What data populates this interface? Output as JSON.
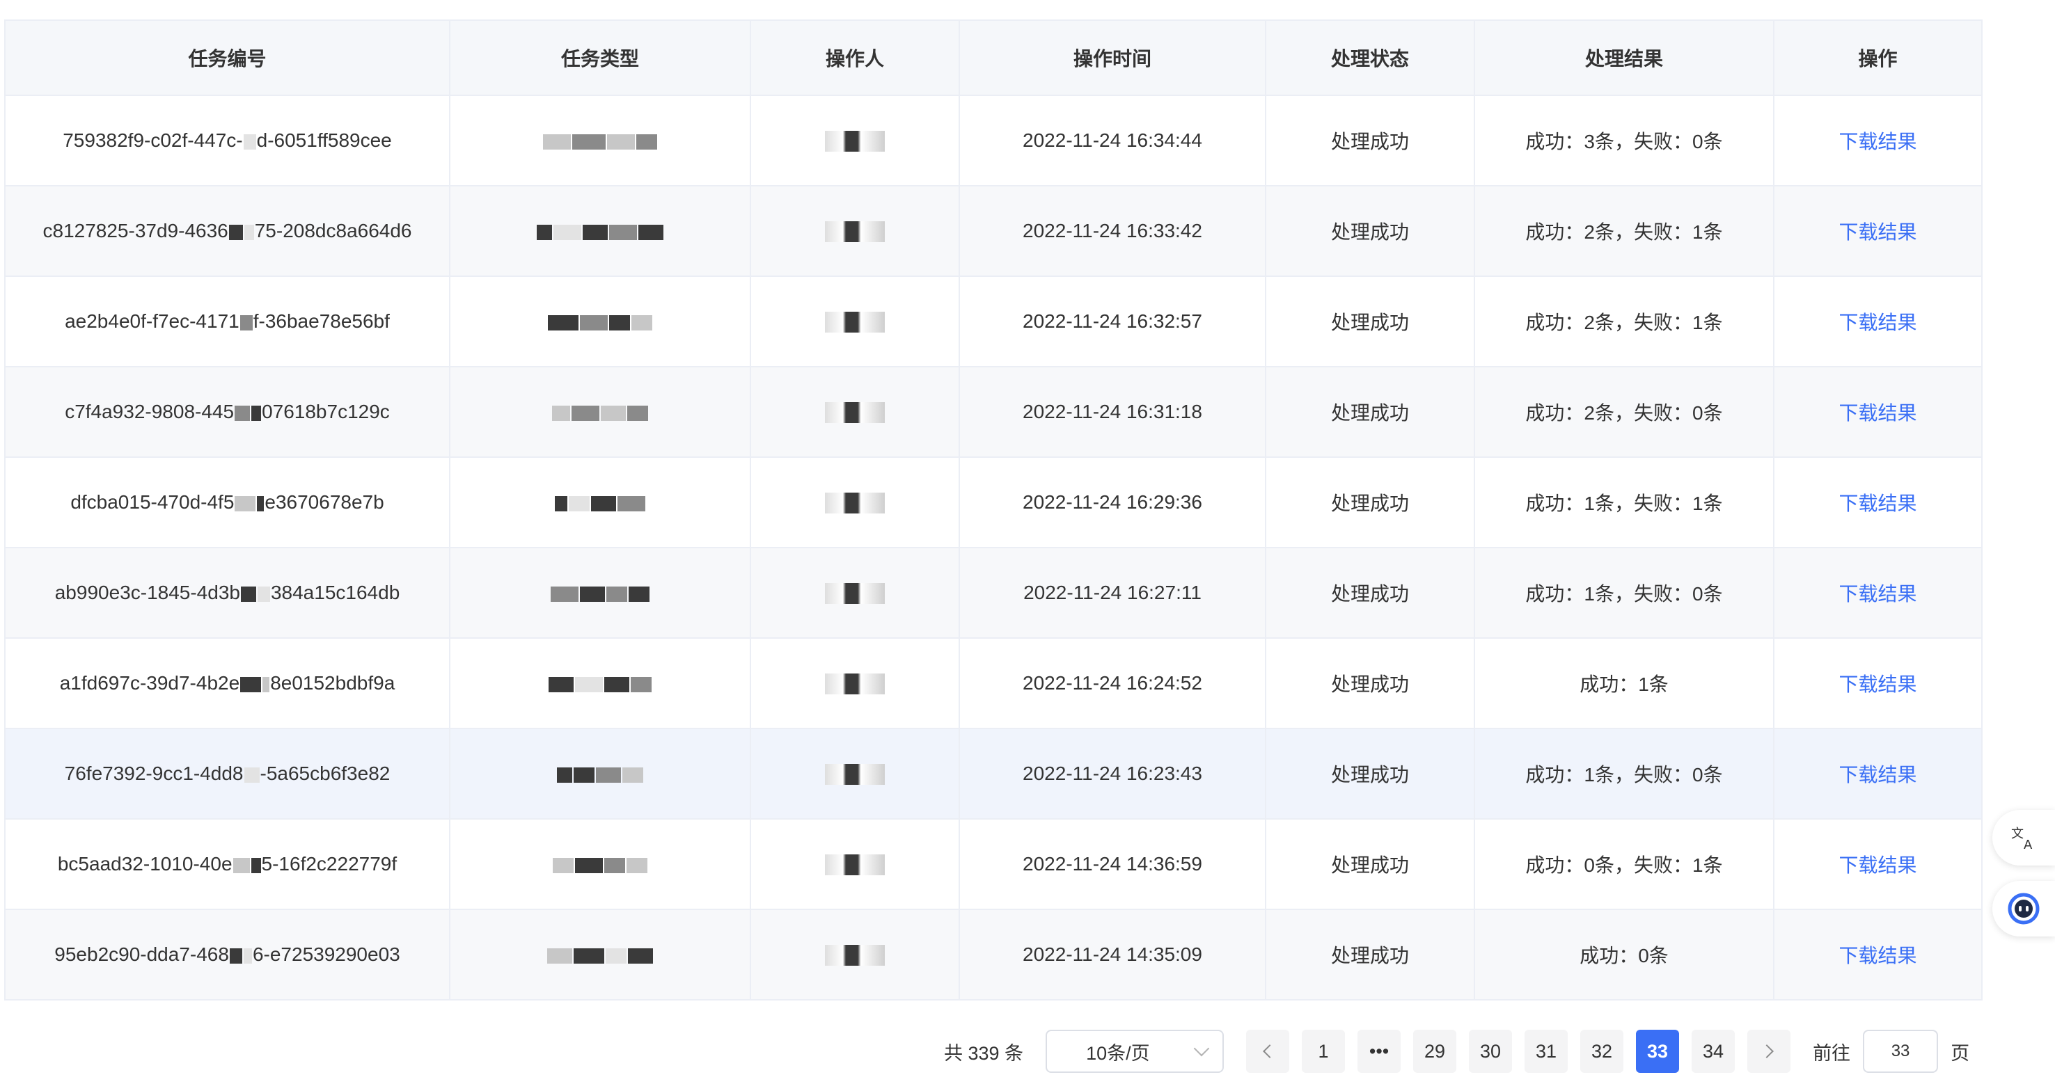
{
  "table": {
    "headers": [
      "任务编号",
      "任务类型",
      "操作人",
      "操作时间",
      "处理状态",
      "处理结果",
      "操作"
    ],
    "rows": [
      {
        "id_start": "759382f9-c02f-447c-",
        "id_end": "d-6051ff589cee",
        "time": "2022-11-24 16:34:44",
        "status": "处理成功",
        "result": "成功：3条，失败：0条",
        "action": "下载结果"
      },
      {
        "id_start": "c8127825-37d9-4636",
        "id_end": "75-208dc8a664d6",
        "time": "2022-11-24 16:33:42",
        "status": "处理成功",
        "result": "成功：2条，失败：1条",
        "action": "下载结果"
      },
      {
        "id_start": "ae2b4e0f-f7ec-4171",
        "id_end": "f-36bae78e56bf",
        "time": "2022-11-24 16:32:57",
        "status": "处理成功",
        "result": "成功：2条，失败：1条",
        "action": "下载结果"
      },
      {
        "id_start": "c7f4a932-9808-445",
        "id_end": "07618b7c129c",
        "time": "2022-11-24 16:31:18",
        "status": "处理成功",
        "result": "成功：2条，失败：0条",
        "action": "下载结果"
      },
      {
        "id_start": "dfcba015-470d-4f5",
        "id_end": "e3670678e7b",
        "time": "2022-11-24 16:29:36",
        "status": "处理成功",
        "result": "成功：1条，失败：1条",
        "action": "下载结果"
      },
      {
        "id_start": "ab990e3c-1845-4d3b",
        "id_end": "384a15c164db",
        "time": "2022-11-24 16:27:11",
        "status": "处理成功",
        "result": "成功：1条，失败：0条",
        "action": "下载结果"
      },
      {
        "id_start": "a1fd697c-39d7-4b2e",
        "id_end": "8e0152bdbf9a",
        "time": "2022-11-24 16:24:52",
        "status": "处理成功",
        "result": "成功：1条",
        "action": "下载结果"
      },
      {
        "id_start": "76fe7392-9cc1-4dd8",
        "id_end": "-5a65cb6f3e82",
        "time": "2022-11-24 16:23:43",
        "status": "处理成功",
        "result": "成功：1条，失败：0条",
        "action": "下载结果"
      },
      {
        "id_start": "bc5aad32-1010-40e",
        "id_end": "5-16f2c222779f",
        "time": "2022-11-24 14:36:59",
        "status": "处理成功",
        "result": "成功：0条，失败：1条",
        "action": "下载结果"
      },
      {
        "id_start": "95eb2c90-dda7-468",
        "id_end": "6-e72539290e03",
        "time": "2022-11-24 14:35:09",
        "status": "处理成功",
        "result": "成功：0条",
        "action": "下载结果"
      }
    ]
  },
  "pagination": {
    "total_label": "共 339 条",
    "page_size_label": "10条/页",
    "pages": [
      "1",
      "29",
      "30",
      "31",
      "32",
      "33",
      "34"
    ],
    "active_page": "33",
    "ellipsis": "•••",
    "goto_label": "前往",
    "goto_value": "33",
    "goto_unit": "页"
  },
  "icons": {
    "prev": "chevron-left-icon",
    "next": "chevron-right-icon",
    "dropdown": "chevron-down-icon",
    "translate": "translate-icon",
    "assistant": "assistant-icon"
  },
  "colors": {
    "accent": "#3a6ff5",
    "header_bg": "#f5f7fa",
    "border": "#ebeef5"
  }
}
